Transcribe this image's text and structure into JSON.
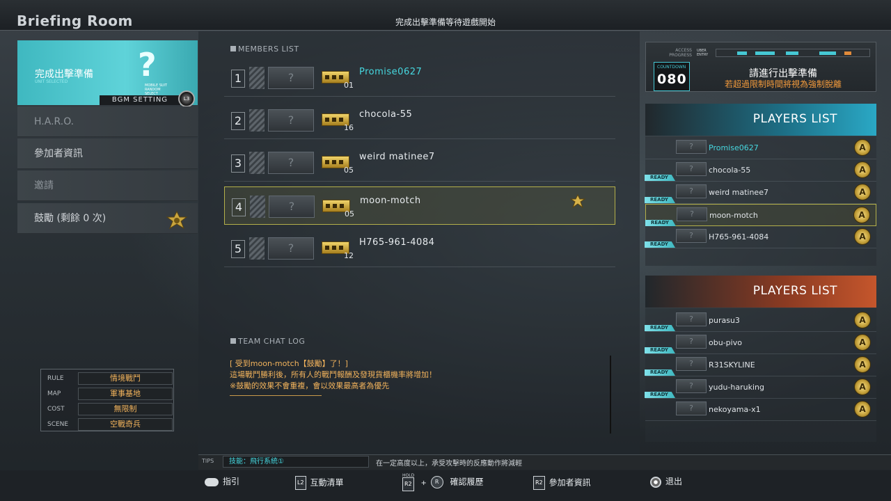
{
  "header": {
    "title": "Briefing Room",
    "status": "完成出擊準備等待遊戲開始"
  },
  "left_menu": {
    "selected_label": "完成出擊準備",
    "selected_sub": "UNIT SELECTED",
    "random_label": "MOBILE SUIT RANDOM SELECT",
    "bgm_label": "BGM SETTING",
    "l3_key": "L3",
    "items": [
      {
        "label": "H.A.R.O.",
        "dim": true
      },
      {
        "label": "參加者資訊",
        "dim": false
      },
      {
        "label": "邀請",
        "dim": true
      },
      {
        "label": "鼓勵 (剩餘 0 次)",
        "dim": false
      }
    ]
  },
  "rules": [
    {
      "key": "RULE",
      "value": "情境戰鬥"
    },
    {
      "key": "MAP",
      "value": "軍事基地"
    },
    {
      "key": "COST",
      "value": "無限制"
    },
    {
      "key": "SCENE",
      "value": "空戰奇兵"
    }
  ],
  "members": {
    "header": "MEMBERS LIST",
    "rows": [
      {
        "num": "1",
        "level": "01",
        "name": "Promise0627",
        "highlight": "cyan",
        "selected": false,
        "medal": false
      },
      {
        "num": "2",
        "level": "16",
        "name": "chocola-55",
        "highlight": "",
        "selected": false,
        "medal": false
      },
      {
        "num": "3",
        "level": "05",
        "name": "weird matinee7",
        "highlight": "",
        "selected": false,
        "medal": false
      },
      {
        "num": "4",
        "level": "05",
        "name": "moon-motch",
        "highlight": "",
        "selected": true,
        "medal": true
      },
      {
        "num": "5",
        "level": "12",
        "name": "H765-961-4084",
        "highlight": "",
        "selected": false,
        "medal": false
      }
    ]
  },
  "chat": {
    "header": "TEAM CHAT LOG",
    "lines": [
      "[ 受到moon-motch【鼓勵】了！]",
      "這場戰鬥勝利後，所有人的戰鬥報酬及發現貨櫃機率將增加！",
      "※鼓勵的效果不會重複，會以效果最高者為優先"
    ]
  },
  "access": {
    "label": "ACCESS PROGRESS",
    "uber": "UBER ENTRY",
    "countdown_label": "COUNTDOWN",
    "countdown_value": "080",
    "prompt": "請進行出擊準備",
    "warning": "若超過限制時間將視為強制脫離"
  },
  "players_blue": {
    "title": "PLAYERS LIST",
    "rows": [
      {
        "name": "Promise0627",
        "ready": false,
        "cyan": true,
        "selected": false
      },
      {
        "name": "chocola-55",
        "ready": true,
        "cyan": false,
        "selected": false
      },
      {
        "name": "weird matinee7",
        "ready": true,
        "cyan": false,
        "selected": false
      },
      {
        "name": "moon-motch",
        "ready": true,
        "cyan": false,
        "selected": true
      },
      {
        "name": "H765-961-4084",
        "ready": true,
        "cyan": false,
        "selected": false
      }
    ]
  },
  "players_red": {
    "title": "PLAYERS LIST",
    "rows": [
      {
        "name": "purasu3",
        "ready": true
      },
      {
        "name": "obu-pivo",
        "ready": true
      },
      {
        "name": "R31SKYLINE",
        "ready": true
      },
      {
        "name": "yudu-haruking",
        "ready": true
      },
      {
        "name": "nekoyama-x1",
        "ready": false
      }
    ]
  },
  "ready_label": "READY",
  "rank_letter": "A",
  "slot_glyph": "?",
  "tips": {
    "label": "TIPS",
    "topic": "技能：飛行系統①",
    "text": "在一定高度以上，承受攻擊時的反應動作將減輕"
  },
  "bottom": {
    "guide": "指引",
    "l2_key": "L2",
    "interact": "互動清單",
    "hold": "HOLD",
    "r2_key": "R2",
    "r_key": "R",
    "history": "確認履歷",
    "r2_key_2": "R2",
    "participant": "參加者資訊",
    "exit": "退出"
  },
  "colors": {
    "accent_cyan": "#46d8e0",
    "accent_orange": "#f2b35c",
    "team_blue": "#2aa8c5",
    "team_red": "#c5562c",
    "selected_border": "#b4b04a"
  }
}
